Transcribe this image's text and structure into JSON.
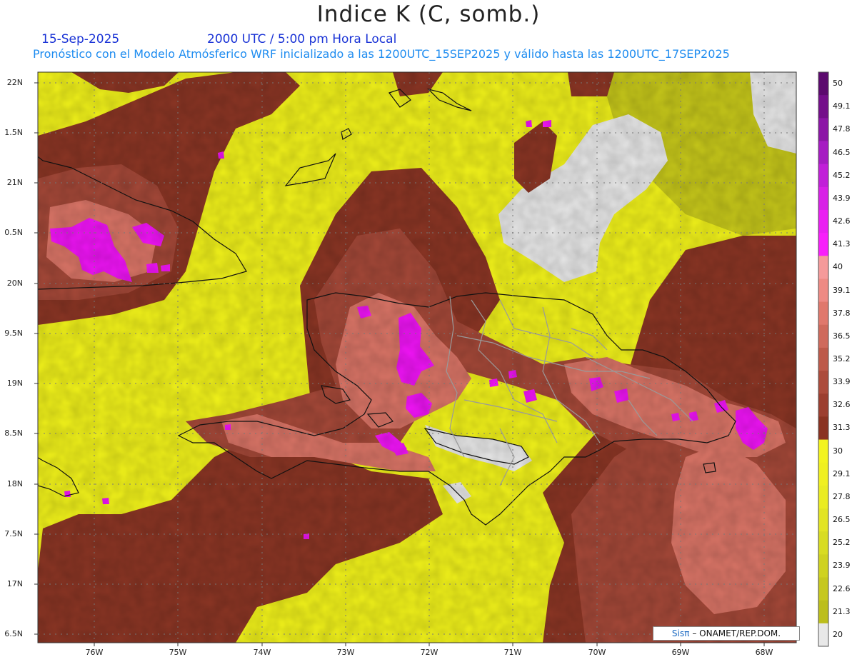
{
  "title": "Indice K (C, somb.)",
  "date": "15-Sep-2025",
  "valid_time": "2000 UTC / 5:00 pm Hora Local",
  "subtitle": "Pronóstico con el Modelo Atmósferico WRF inicializado a las 1200UTC_15SEP2025 y válido hasta las  1200UTC_17SEP2025",
  "credit": {
    "brand": "Sisπ",
    "text": "– ONAMET/REP.DOM."
  },
  "lat_ticks": [
    "22N",
    "1.5N",
    "21N",
    "0.5N",
    "20N",
    "9.5N",
    "19N",
    "8.5N",
    "18N",
    "7.5N",
    "17N",
    "6.5N"
  ],
  "lon_ticks": [
    "76W",
    "75W",
    "74W",
    "73W",
    "72W",
    "71W",
    "70W",
    "69W",
    "68W"
  ],
  "colorbar": {
    "labels": [
      "50",
      "49.1",
      "47.8",
      "46.5",
      "45.2",
      "43.9",
      "42.6",
      "41.3",
      "40",
      "39.1",
      "37.8",
      "36.5",
      "35.2",
      "33.9",
      "32.6",
      "31.3",
      "30",
      "29.1",
      "27.8",
      "26.5",
      "25.2",
      "23.9",
      "22.6",
      "21.3",
      "20"
    ],
    "colors": [
      "#5c0a6e",
      "#740f8a",
      "#8c16a6",
      "#a61cc2",
      "#c11fd8",
      "#d820e6",
      "#ea1ef2",
      "#f81efa",
      "#f59a9a",
      "#ee8a84",
      "#e0786c",
      "#cf6a5c",
      "#bd5a4a",
      "#ac4c3c",
      "#9c3f30",
      "#8a3322",
      "#f3f41e",
      "#f0f020",
      "#eaec22",
      "#e2e424",
      "#d8dc22",
      "#cfd220",
      "#c6c81e",
      "#bcbe1c",
      "#e8e8e8"
    ]
  },
  "colors": {
    "yellow": "#f1f21a",
    "olive": "#c6c71a",
    "dark_brown": "#8a3524",
    "brown": "#a44838",
    "salmon": "#d97466",
    "magenta": "#f014f6",
    "grey": "#e8e8e8"
  }
}
